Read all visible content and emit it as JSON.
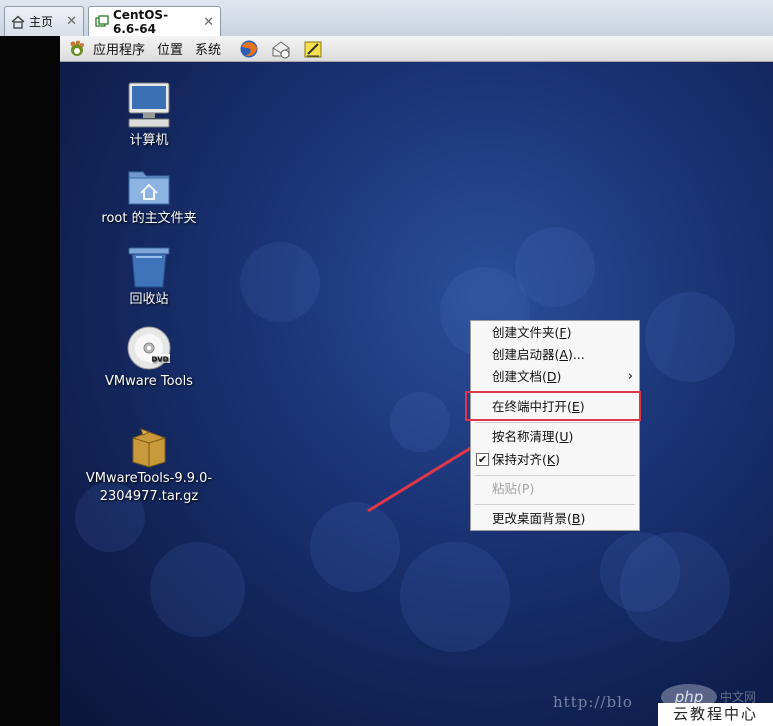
{
  "tabs": [
    {
      "label": "主页",
      "icon": "home-icon"
    },
    {
      "label": "CentOS-6.6-64",
      "icon": "vm-icon",
      "active": true
    }
  ],
  "panel": {
    "menus": [
      "应用程序",
      "位置",
      "系统"
    ],
    "launchers": [
      "firefox-icon",
      "mail-icon",
      "notes-icon"
    ]
  },
  "desktop_icons": [
    {
      "label": "计算机",
      "icon": "computer-icon"
    },
    {
      "label": "root 的主文件夹",
      "icon": "home-folder-icon"
    },
    {
      "label": "回收站",
      "icon": "trash-icon"
    },
    {
      "label": "VMware Tools",
      "icon": "dvd-icon"
    },
    {
      "label": "VMwareTools-9.9.0-\n2304977.tar.gz",
      "line1": "VMwareTools-9.9.0-",
      "line2": "2304977.tar.gz",
      "icon": "archive-icon"
    }
  ],
  "context_menu": {
    "items": [
      {
        "label": "创建文件夹(F)",
        "pre": "创建文件夹(",
        "key": "F",
        "post": ")"
      },
      {
        "label": "创建启动器(A)...",
        "pre": "创建启动器(",
        "key": "A",
        "post": ")..."
      },
      {
        "label": "创建文档(D)",
        "pre": "创建文档(",
        "key": "D",
        "post": ")",
        "submenu": true
      },
      {
        "label": "在终端中打开(E)",
        "pre": "在终端中打开(",
        "key": "E",
        "post": ")",
        "highlighted": true
      },
      {
        "label": "按名称清理(U)",
        "pre": "按名称清理(",
        "key": "U",
        "post": ")"
      },
      {
        "label": "保持对齐(K)",
        "pre": "保持对齐(",
        "key": "K",
        "post": ")",
        "checked": true
      },
      {
        "label": "粘贴(P)",
        "pre": "粘贴(",
        "key": "P",
        "post": ")",
        "disabled": true
      },
      {
        "label": "更改桌面背景(B)",
        "pre": "更改桌面背景(",
        "key": "B",
        "post": ")"
      }
    ],
    "check_mark": "✔",
    "submenu_arrow": "›"
  },
  "watermark": {
    "url": "http://blo",
    "logo": "php",
    "cn": "中文网",
    "brand": "云教程中心"
  },
  "colors": {
    "highlight_box": "#e0364a",
    "arrow": "#e0364a",
    "desktop": "#1c3578"
  }
}
